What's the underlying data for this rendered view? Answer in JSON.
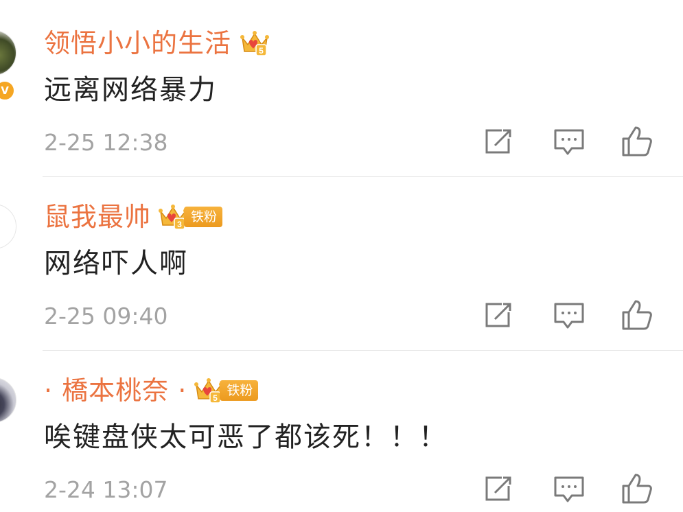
{
  "comments": [
    {
      "username": "领悟小小的生活",
      "content": "远离网络暴力",
      "time": "2-25 12:38",
      "member_level": "5",
      "fan_label": "",
      "verified_badge": "V",
      "avatar_icon": "avatar-photo"
    },
    {
      "username": "鼠我最帅",
      "content": "网络吓人啊",
      "time": "2-25 09:40",
      "member_level": "3",
      "fan_label": "铁粉",
      "avatar_icon": "avatar-photo"
    },
    {
      "username": "· 橋本桃奈 ·",
      "content": "唉键盘侠太可恶了都该死！！！",
      "time": "2-24 13:07",
      "member_level": "5",
      "fan_label": "铁粉",
      "avatar_icon": "avatar-photo"
    }
  ],
  "actions": {
    "forward_icon": "forward-edit-icon",
    "reply_icon": "comment-bubble-icon",
    "like_icon": "thumbs-up-icon"
  },
  "colors": {
    "username": "#eb7340",
    "content": "#222222",
    "timestamp": "#a3a3a3",
    "icon_stroke": "#7a7a7a",
    "crown_gold": "#f5b83a",
    "crown_red": "#e8453c",
    "fan_tag_bg": "#f2a52b",
    "divider": "#e5e5e5"
  }
}
